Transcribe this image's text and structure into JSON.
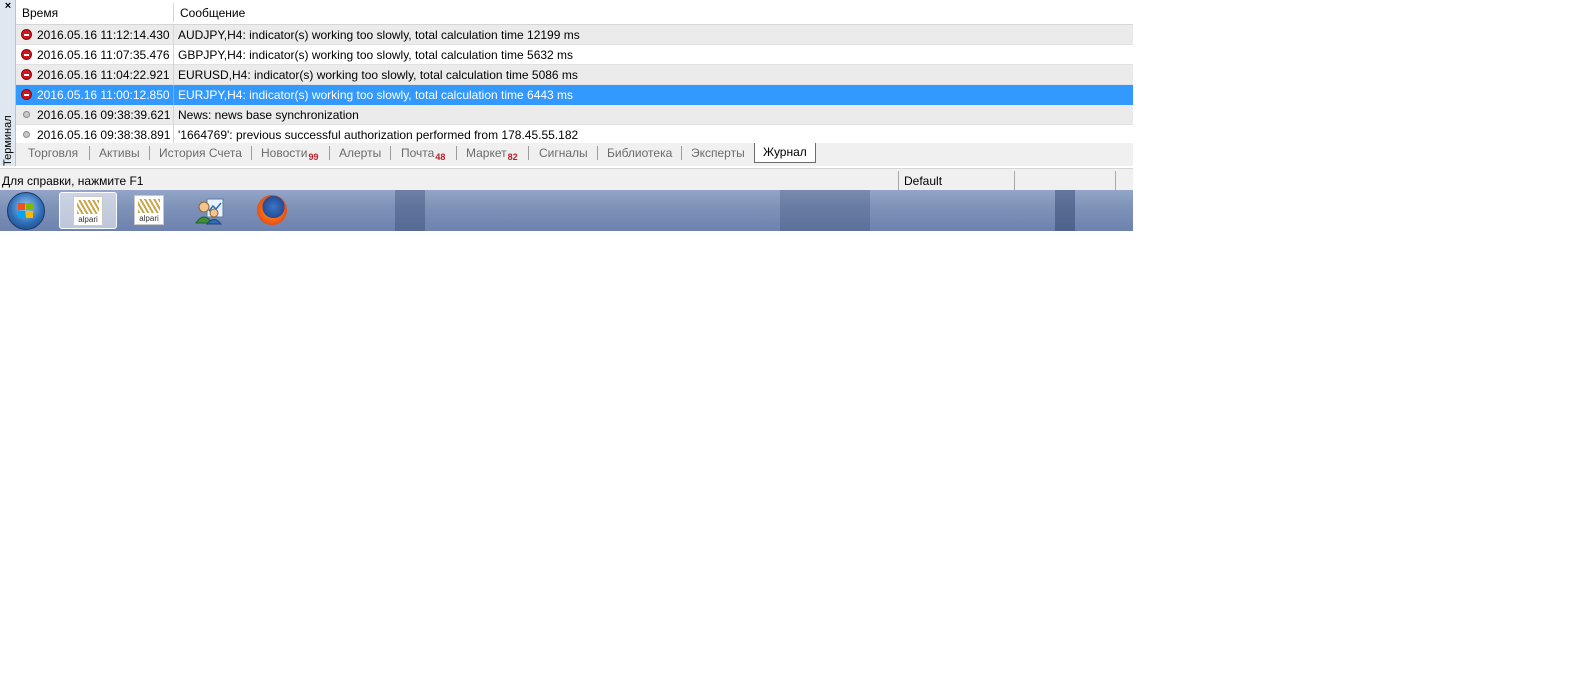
{
  "terminal": {
    "close_glyph": "×",
    "side_label": "Терминал"
  },
  "journal": {
    "columns": [
      "Время",
      "Сообщение"
    ],
    "rows": [
      {
        "icon": "error-icon",
        "time": "2016.05.16 11:12:14.430",
        "message": "AUDJPY,H4: indicator(s) working too slowly, total calculation time 12199 ms",
        "selected": false
      },
      {
        "icon": "error-icon",
        "time": "2016.05.16 11:07:35.476",
        "message": "GBPJPY,H4: indicator(s) working too slowly, total calculation time 5632 ms",
        "selected": false
      },
      {
        "icon": "error-icon",
        "time": "2016.05.16 11:04:22.921",
        "message": "EURUSD,H4: indicator(s) working too slowly, total calculation time 5086 ms",
        "selected": false
      },
      {
        "icon": "error-icon",
        "time": "2016.05.16 11:00:12.850",
        "message": "EURJPY,H4: indicator(s) working too slowly, total calculation time 6443 ms",
        "selected": true
      },
      {
        "icon": "info-icon",
        "time": "2016.05.16 09:38:39.621",
        "message": "News: news base synchronization",
        "selected": false
      },
      {
        "icon": "info-icon",
        "time": "2016.05.16 09:38:38.891",
        "message": "'1664769': previous successful authorization performed from 178.45.55.182",
        "selected": false
      }
    ]
  },
  "tabs": [
    {
      "label": "Торговля",
      "badge": ""
    },
    {
      "label": "Активы",
      "badge": ""
    },
    {
      "label": "История Счета",
      "badge": ""
    },
    {
      "label": "Новости",
      "badge": "99"
    },
    {
      "label": "Алерты",
      "badge": ""
    },
    {
      "label": "Почта",
      "badge": "48"
    },
    {
      "label": "Маркет",
      "badge": "82"
    },
    {
      "label": "Сигналы",
      "badge": ""
    },
    {
      "label": "Библиотека",
      "badge": ""
    },
    {
      "label": "Эксперты",
      "badge": ""
    },
    {
      "label": "Журнал",
      "badge": "",
      "active": true
    }
  ],
  "status": {
    "help_text": "Для справки, нажмите F1",
    "profile": "Default"
  },
  "taskbar": {
    "apps": [
      {
        "name": "alpari-terminal-1",
        "label": "alpari",
        "active": true
      },
      {
        "name": "alpari-terminal-2",
        "label": "alpari",
        "active": false
      },
      {
        "name": "network-app",
        "label": "",
        "active": false
      },
      {
        "name": "firefox",
        "label": "",
        "active": false
      }
    ]
  },
  "colors": {
    "selection": "#3399ff",
    "error": "#d2141c",
    "badge": "#c0202a"
  }
}
